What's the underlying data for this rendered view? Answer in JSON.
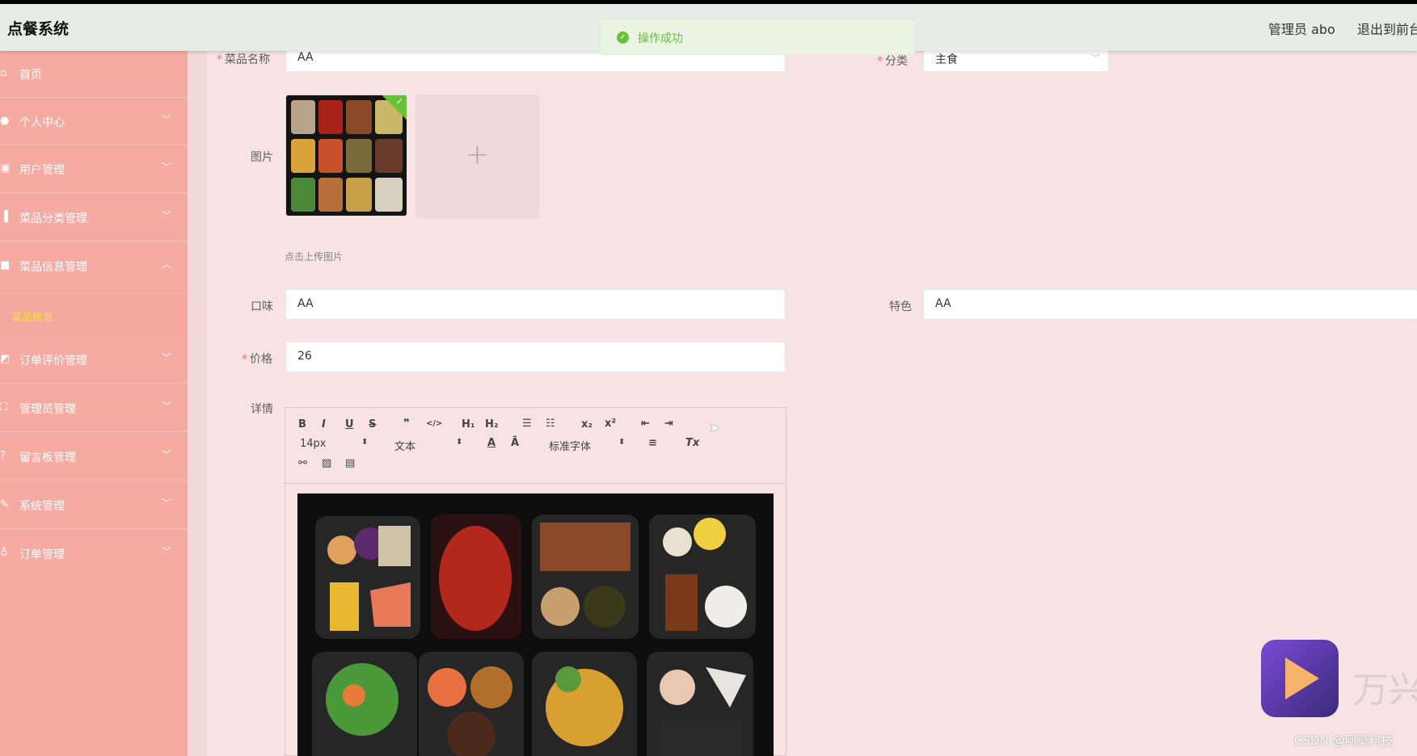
{
  "header": {
    "brand": "点餐系统",
    "admin": "管理员 abo",
    "exit": "退出到前台"
  },
  "toast": {
    "message": "操作成功"
  },
  "sidebar": {
    "items": [
      {
        "label": "首页",
        "icon": "home-icon",
        "icon_glyph": "⌂",
        "expandable": false
      },
      {
        "label": "个人中心",
        "icon": "user-icon",
        "icon_glyph": "●",
        "expandable": true
      },
      {
        "label": "用户管理",
        "icon": "user-manage-icon",
        "icon_glyph": "▣",
        "expandable": true
      },
      {
        "label": "菜品分类管理",
        "icon": "bar-chart-icon",
        "icon_glyph": "▐",
        "expandable": true
      },
      {
        "label": "菜品信息管理",
        "icon": "video-icon",
        "icon_glyph": "■",
        "expandable": true,
        "open": true
      },
      {
        "label": "订单评价管理",
        "icon": "line-chart-icon",
        "icon_glyph": "◩",
        "expandable": true
      },
      {
        "label": "管理员管理",
        "icon": "frame-icon",
        "icon_glyph": "⛶",
        "expandable": true
      },
      {
        "label": "留言板管理",
        "icon": "help-icon",
        "icon_glyph": "?",
        "expandable": true
      },
      {
        "label": "系统管理",
        "icon": "edit-icon",
        "icon_glyph": "✎",
        "expandable": true
      },
      {
        "label": "订单管理",
        "icon": "microphone-icon",
        "icon_glyph": "♁",
        "expandable": true
      }
    ],
    "submenu": {
      "label": "菜品信息"
    },
    "arrow_down": "﹀",
    "arrow_up": "︿"
  },
  "form": {
    "name_label": "菜品名称",
    "name_value": "AA",
    "category_label": "分类",
    "category_value": "主食",
    "image_label": "图片",
    "upload_plus": "+",
    "upload_tip": "点击上传图片",
    "taste_label": "口味",
    "taste_value": "AA",
    "feature_label": "特色",
    "feature_value": "AA",
    "price_label": "价格",
    "price_value": "26",
    "detail_label": "详情",
    "required_mark": "*"
  },
  "editor": {
    "size_value": "14px",
    "format_value": "文本",
    "font_value": "标准字体",
    "buttons": {
      "bold": "B",
      "italic": "I",
      "underline": "U",
      "strike": "S",
      "quote": "❞",
      "code": "</>",
      "h1": "H₁",
      "h2": "H₂",
      "ol": "☰",
      "ul": "☷",
      "sub": "x₂",
      "sup": "x²",
      "outdent": "⇤",
      "indent": "⇥",
      "color": "A",
      "bg": "Ā",
      "align": "≡",
      "clean": "Tx",
      "link": "⚯",
      "image": "▨",
      "video": "▤"
    },
    "select_arrow": "⬍"
  },
  "watermark": {
    "text": "万兴",
    "csdn": "CSDN @阿莫科技"
  },
  "cursor": "➤"
}
